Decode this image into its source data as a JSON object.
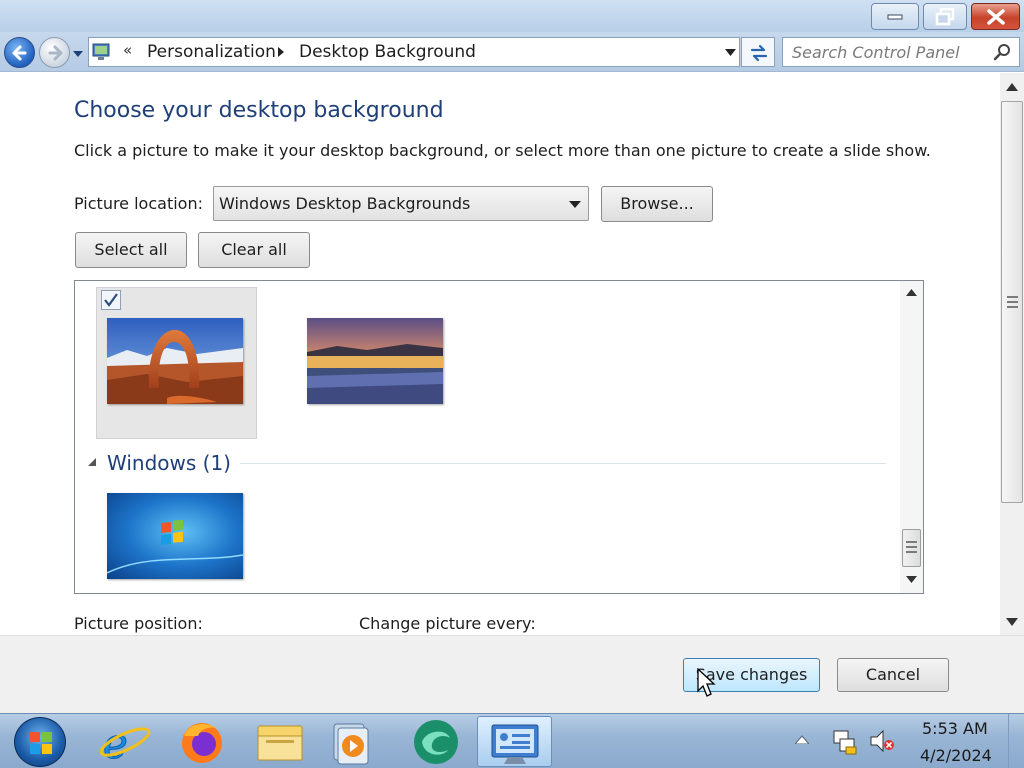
{
  "window": {
    "controls": {
      "minimize": "minimize",
      "maximize": "restore",
      "close": "close"
    }
  },
  "address": {
    "chevron": "«",
    "breadcrumbs": [
      "Personalization",
      "Desktop Background"
    ]
  },
  "search": {
    "placeholder": "Search Control Panel"
  },
  "main": {
    "title": "Choose your desktop background",
    "intro": "Click a picture to make it your desktop background, or select more than one picture to create a slide show.",
    "picture_location_label": "Picture location:",
    "picture_location_value": "Windows Desktop Backgrounds",
    "browse_label": "Browse...",
    "select_all_label": "Select all",
    "clear_all_label": "Clear all",
    "pictures": [
      {
        "name": "delicate-arch",
        "selected": true
      },
      {
        "name": "wildflower-lake",
        "selected": false
      }
    ],
    "group": {
      "title": "Windows (1)",
      "pictures": [
        {
          "name": "windows-7-default",
          "selected": false
        }
      ]
    },
    "picture_position_label": "Picture position:",
    "change_picture_label": "Change picture every:"
  },
  "footer": {
    "save_label": "Save changes",
    "cancel_label": "Cancel"
  },
  "taskbar": {
    "pinned": [
      "internet-explorer-icon",
      "firefox-icon",
      "file-explorer-icon",
      "media-player-icon",
      "app-icon",
      "control-panel-icon"
    ],
    "clock_time": "5:53 AM",
    "clock_date": "4/2/2024"
  },
  "colors": {
    "title_blue": "#1e3f78",
    "taskbar": "#9ab6d6",
    "save_button": "#bee6fd"
  }
}
